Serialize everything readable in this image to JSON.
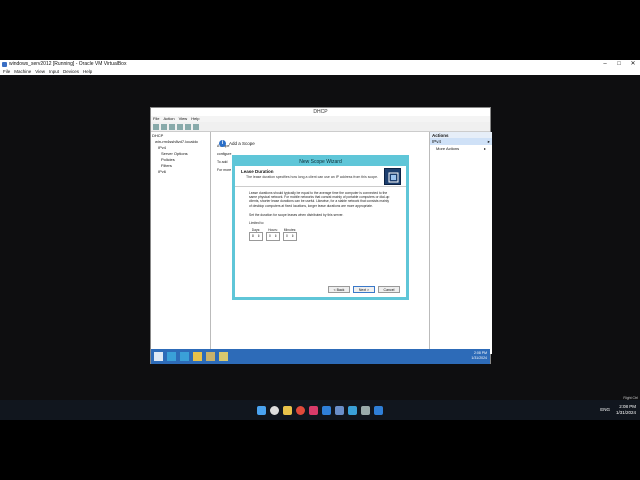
{
  "virtualbox": {
    "title": "windows_serv2012 [Running] - Oracle VM VirtualBox",
    "menu": [
      "File",
      "Machine",
      "View",
      "Input",
      "Devices",
      "Help"
    ]
  },
  "dhcp": {
    "title": "DHCP",
    "menu": [
      "File",
      "Action",
      "View",
      "Help"
    ],
    "tree": [
      "DHCP",
      "win-rm4ssh8vd7.localdo",
      "IPv4",
      "Server Options",
      "Policies",
      "Filters",
      "IPv6"
    ],
    "add_scope": "Add a Scope",
    "center_snippets": [
      "A scope",
      "configure",
      "To add",
      "For more"
    ],
    "actions": {
      "header": "Actions",
      "selected": "IPv4",
      "more": "More Actions"
    }
  },
  "wizard": {
    "title": "New Scope Wizard",
    "heading": "Lease Duration",
    "subheading": "The lease duration specifies how long a client can use an IP address from this scope.",
    "para": "Lease durations should typically be equal to the average time the computer is connected to the same physical network. For mobile networks that consist mainly of portable computers or dial-up clients, shorter lease durations can be useful. Likewise, for a stable network that consists mainly of desktop computers at fixed locations, longer lease durations are more appropriate.",
    "instruction": "Set the duration for scope leases when distributed by this server.",
    "limited_to": "Limited to:",
    "days_label": "Days:",
    "days": "8",
    "hours_label": "Hours:",
    "hours": "0",
    "minutes_label": "Minutes:",
    "minutes": "0",
    "back": "< Back",
    "next": "Next >",
    "cancel": "Cancel"
  },
  "guest_taskbar": {
    "time": "2:08 PM",
    "date": "1/31/2024"
  },
  "host_tray": {
    "lang": "ENG",
    "time": "2:08 PM",
    "date": "1/31/2024",
    "right_ctrl": "Right Ctrl"
  },
  "colors": {
    "wizard_border": "#5fc6d8",
    "guest_taskbar": "#2d6bb8",
    "host_taskbar": "#11161e"
  }
}
